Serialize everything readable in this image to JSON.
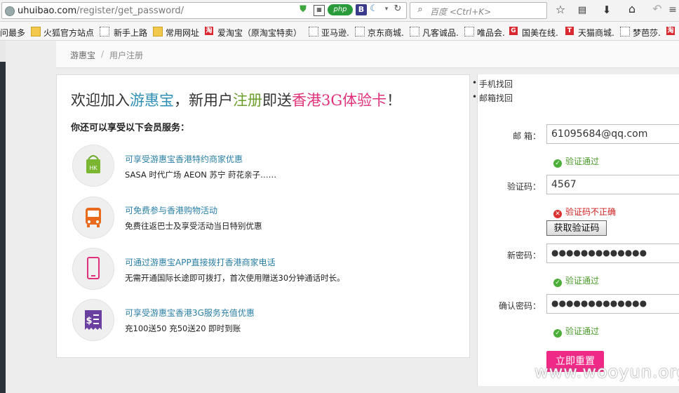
{
  "browser": {
    "url_host": "uhuibao.com",
    "url_path": "/register/get_password/",
    "search_placeholder": "百度 <Ctrl+K>",
    "bookmarks": [
      "问最多",
      "火狐官方站点",
      "新手上路",
      "常用网址",
      "爱淘宝（原淘宝特卖）",
      "亚马逊.",
      "京东商城.",
      "凡客诚品.",
      "唯品会.",
      "国美在线.",
      "天猫商城.",
      "梦芭莎."
    ],
    "icons": [
      "globe-icon",
      "shield-icon",
      "qr-icon",
      "php-icon",
      "b-icon",
      "moon-icon",
      "reload-icon",
      "search-icon",
      "star-icon",
      "bookmarks-icon",
      "download-icon",
      "home-icon",
      "back-icon",
      "menu-icon"
    ]
  },
  "breadcrumb": {
    "home": "游惠宝",
    "separator": "/",
    "current": "用户注册"
  },
  "promo": {
    "headline": {
      "part1": "欢迎加入",
      "brand": "游惠宝",
      "part2": "，新用户",
      "register": "注册",
      "part3": "即送",
      "card": "香港3G体验卡",
      "end": "！"
    },
    "subhead": "你还可以享受以下会员服务：",
    "services": [
      {
        "icon": "shopping-bag-icon",
        "badge": "HK",
        "title": "可享受游惠宝香港特约商家优惠",
        "desc": "SASA 时代广场 AEON 苏宁 莳花亲子……"
      },
      {
        "icon": "bus-icon",
        "title": "可免费参与香港购物活动",
        "desc": "免费往返巴士及享受活动当日特别优惠"
      },
      {
        "icon": "phone-icon",
        "title": "可通过游惠宝APP直接拨打香港商家电话",
        "desc": "无需开通国际长途即可拨打，首次使用赠送30分钟通话时长。"
      },
      {
        "icon": "sim-card-icon",
        "title": "可享受游惠宝香港3G服务充值优惠",
        "desc": "充100送50 充50送20  即时到账"
      }
    ]
  },
  "form": {
    "links": [
      "手机找回",
      "邮箱找回"
    ],
    "email_label": "邮 箱：",
    "email_value": "61095684@qq.com",
    "email_status": "验证通过",
    "code_label": "验证码：",
    "code_value": "4567",
    "code_status": "验证码不正确",
    "get_code_label": "获取验证码",
    "password_label": "新密码：",
    "password_value": "●●●●●●●●●●●●●",
    "password_status": "验证通过",
    "confirm_label": "确认密码：",
    "confirm_value": "●●●●●●●●●●●●●",
    "confirm_status": "验证通过",
    "submit_label": "立即重置"
  },
  "watermark": "www.wooyun.org",
  "colors": {
    "brand_blue": "#2f8fb5",
    "register_green": "#6b9f2a",
    "card_pink": "#e0307a",
    "submit_pink": "#ee2a86",
    "ok_green": "#4a9a2a",
    "error_red": "#d02020"
  }
}
